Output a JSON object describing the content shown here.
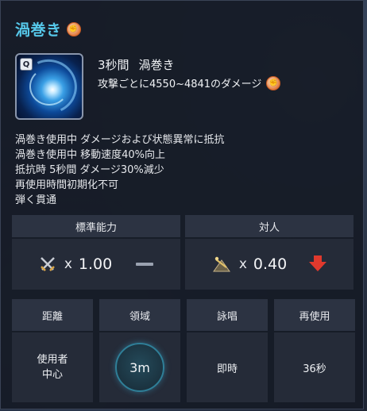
{
  "skill": {
    "name": "渦巻き",
    "key": "Q",
    "cast_line": [
      "3秒間",
      "渦巻き"
    ],
    "damage_text": "攻撃ごとに4550~4841のダメージ"
  },
  "description": [
    "渦巻き使用中 ダメージおよび状態異常に抵抗",
    "渦巻き使用中 移動速度40%向上",
    "抵抗時 5秒間 ダメージ30%減少",
    "再使用時間初期化不可",
    "弾く貫通"
  ],
  "stats": {
    "standard": {
      "label": "標準能力",
      "multiplier": "x",
      "value": "1.00",
      "indicator": "neutral"
    },
    "pvp": {
      "label": "対人",
      "multiplier": "x",
      "value": "0.40",
      "indicator": "down",
      "indicator_color": "#e0392d"
    }
  },
  "details": [
    {
      "header": "距離",
      "value": "使用者\n中心"
    },
    {
      "header": "領域",
      "value": "3m"
    },
    {
      "header": "詠唱",
      "value": "即時"
    },
    {
      "header": "再使用",
      "value": "36秒"
    }
  ],
  "colors": {
    "title": "#56c8ea",
    "panel": "#161b26"
  },
  "icons": [
    "fist-icon",
    "swords-icon",
    "pvp-icon",
    "down-arrow-icon",
    "neutral-dash-icon"
  ]
}
